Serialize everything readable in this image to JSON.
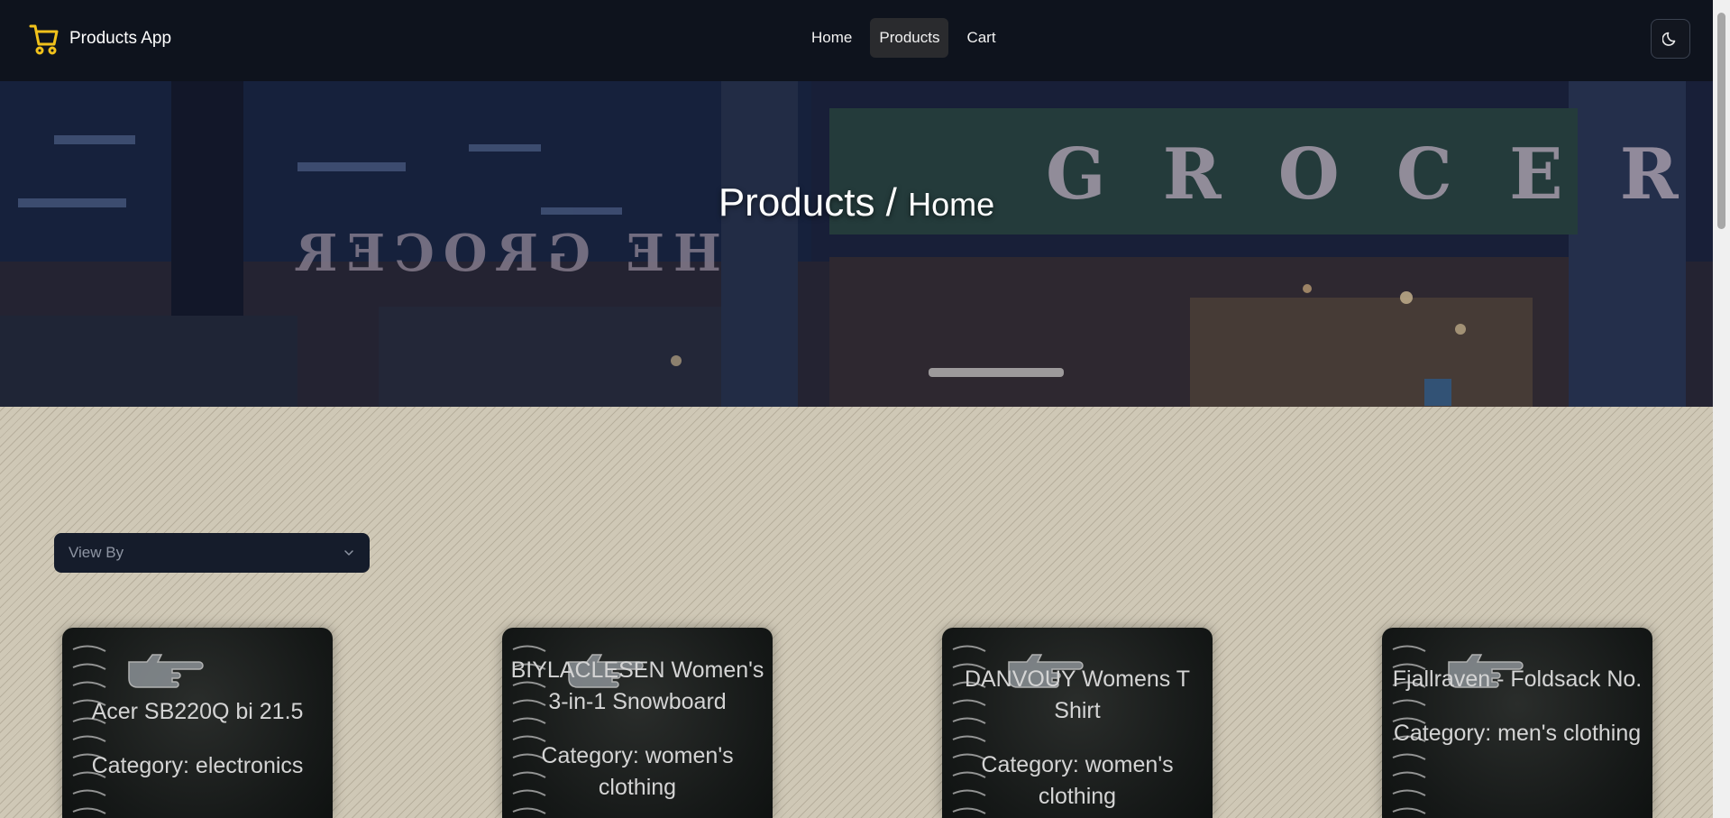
{
  "app": {
    "title": "Products App"
  },
  "nav": {
    "links": [
      {
        "label": "Home",
        "active": false
      },
      {
        "label": "Products",
        "active": true
      },
      {
        "label": "Cart",
        "active": false
      }
    ]
  },
  "hero": {
    "title_main": "Products /",
    "title_current": "Home"
  },
  "filter": {
    "placeholder": "View By"
  },
  "products": [
    {
      "title": "Acer SB220Q bi 21.5",
      "category": "Category: electronics"
    },
    {
      "title": "BIYLACLESEN Women's 3-in-1 Snowboard",
      "category": "Category: women's clothing"
    },
    {
      "title": "DANVOUY Womens T Shirt",
      "category": "Category: women's clothing"
    },
    {
      "title": "Fjallraven - Foldsack No.",
      "category": "Category: men's clothing"
    }
  ],
  "colors": {
    "brand": "#f1c21b",
    "nav_bg": "#0e131d",
    "active_bg": "#2a2b2e"
  },
  "icons": {
    "brand": "shopping-cart-icon",
    "theme": "moon-icon",
    "dropdown": "chevron-down-icon"
  }
}
